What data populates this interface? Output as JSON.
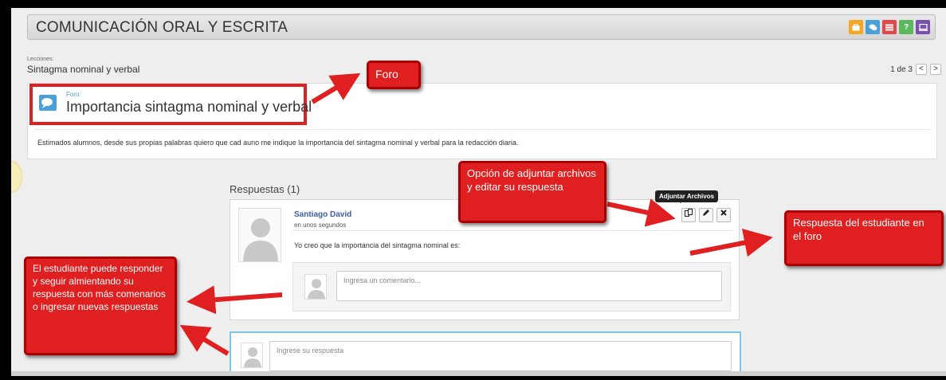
{
  "header": {
    "course_title": "COMUNICACIÓN ORAL Y ESCRITA",
    "icons": [
      {
        "name": "briefcase-icon",
        "color": "#f5a623"
      },
      {
        "name": "chat-icon",
        "color": "#4aa0d8"
      },
      {
        "name": "list-icon",
        "color": "#e04a4a"
      },
      {
        "name": "help-icon",
        "color": "#5cb85c",
        "glyph": "?"
      },
      {
        "name": "monitor-icon",
        "color": "#7a4fb0"
      }
    ]
  },
  "lessons": {
    "label": "Lecciones:",
    "name": "Sintagma nominal y verbal",
    "pager_text": "1 de 3",
    "prev": "<",
    "next": ">"
  },
  "forum": {
    "type_label": "Foro:",
    "title": "Importancia sintagma nominal y verbal",
    "body": "Estimados alumnos, desde sus propias palabras quiero que cad auno me indique la importancia del sintagma nominal y verbal para la redacción diaria."
  },
  "responses": {
    "title": "Respuestas (1)",
    "reply": {
      "author": "Santiago David",
      "time": "en unos segundos",
      "text": "Yo creo que la importancia del sintagma nominal es:",
      "comment_placeholder": "Ingresa un comentario...",
      "tooltip": "Adjuntar Archivos"
    },
    "new_answer_placeholder": "Ingrese su respuesta"
  },
  "callouts": {
    "foro": "Foro",
    "adjuntar": "Opción de adjuntar archivos y editar su respuesta",
    "respuesta": "Respuesta del estudiante en el foro",
    "estudiante": "El estudiante puede responder y seguir almientando su respuesta con más comenarios o ingresar nuevas respuestas"
  },
  "colors": {
    "callout": "#e02020",
    "accent": "#4aa0d8",
    "author": "#3a5fa0"
  }
}
